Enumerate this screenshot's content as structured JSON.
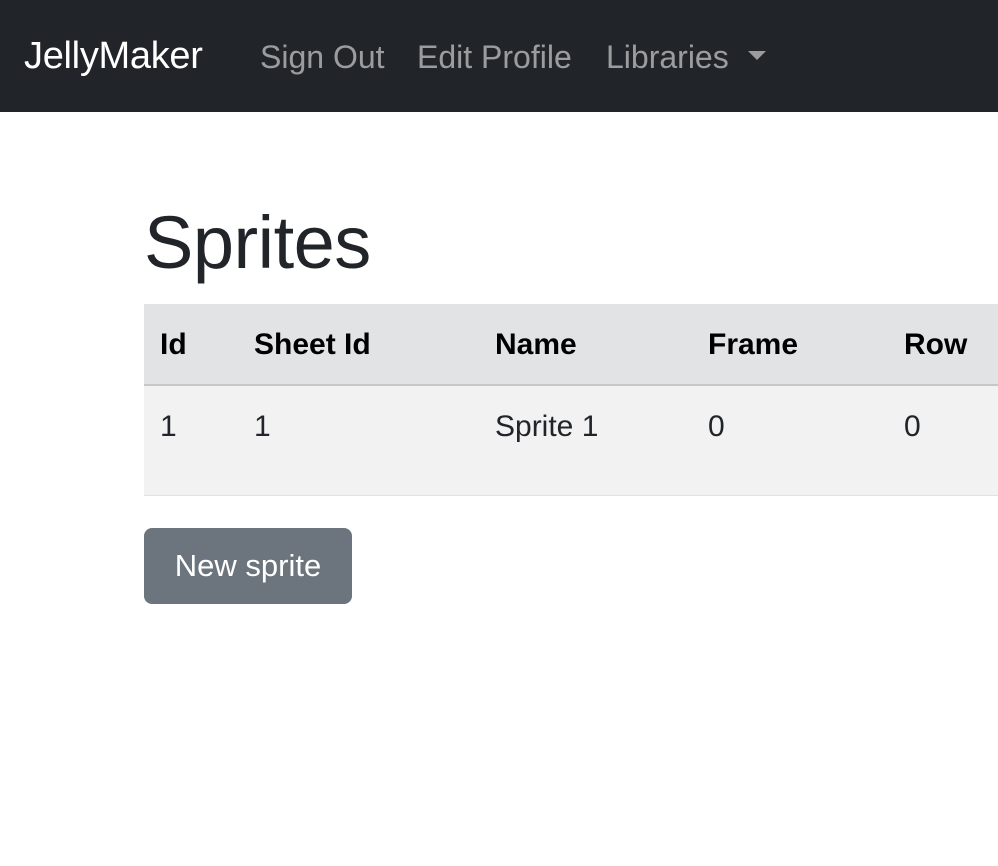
{
  "navbar": {
    "brand": "JellyMaker",
    "links": [
      "Sign Out",
      "Edit Profile",
      "Libraries"
    ],
    "background": "#212529"
  },
  "page": {
    "title": "Sprites"
  },
  "table": {
    "headers": [
      "Id",
      "Sheet Id",
      "Name",
      "Frame",
      "Row"
    ],
    "rows": [
      [
        "1",
        "1",
        "Sprite 1",
        "0",
        "0"
      ]
    ]
  },
  "actions": {
    "new_label": "New sprite",
    "button_color": "#6c757d"
  },
  "icons": {
    "dropdown": "caret-down-icon"
  }
}
